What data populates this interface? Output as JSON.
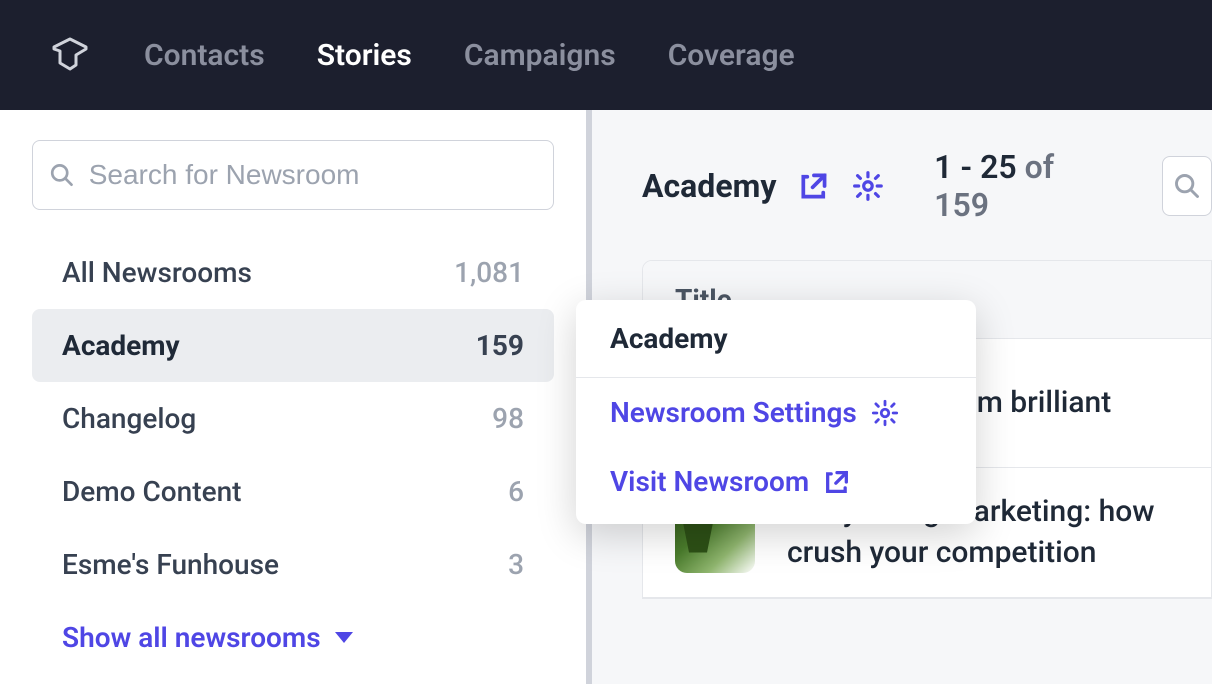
{
  "nav": {
    "items": [
      {
        "label": "Contacts",
        "active": false
      },
      {
        "label": "Stories",
        "active": true
      },
      {
        "label": "Campaigns",
        "active": false
      },
      {
        "label": "Coverage",
        "active": false
      }
    ]
  },
  "sidebar": {
    "search_placeholder": "Search for Newsroom",
    "items": [
      {
        "label": "All Newsrooms",
        "count": "1,081",
        "active": false
      },
      {
        "label": "Academy",
        "count": "159",
        "active": true
      },
      {
        "label": "Changelog",
        "count": "98",
        "active": false
      },
      {
        "label": "Demo Content",
        "count": "6",
        "active": false
      },
      {
        "label": "Esme's Funhouse",
        "count": "3",
        "active": false
      }
    ],
    "show_all_label": "Show all newsrooms"
  },
  "main": {
    "title": "Academy",
    "pagination_range": "1 - 25",
    "pagination_of": " of 159",
    "table_header": "Title",
    "rows": [
      {
        "title": "torytelling exam brilliant"
      },
      {
        "title": "Storytelling marketing: how crush your competition"
      }
    ]
  },
  "popup": {
    "title": "Academy",
    "settings_label": "Newsroom Settings",
    "visit_label": "Visit Newsroom"
  },
  "colors": {
    "accent": "#4f46e5",
    "nav_bg": "#1c1f2e"
  }
}
